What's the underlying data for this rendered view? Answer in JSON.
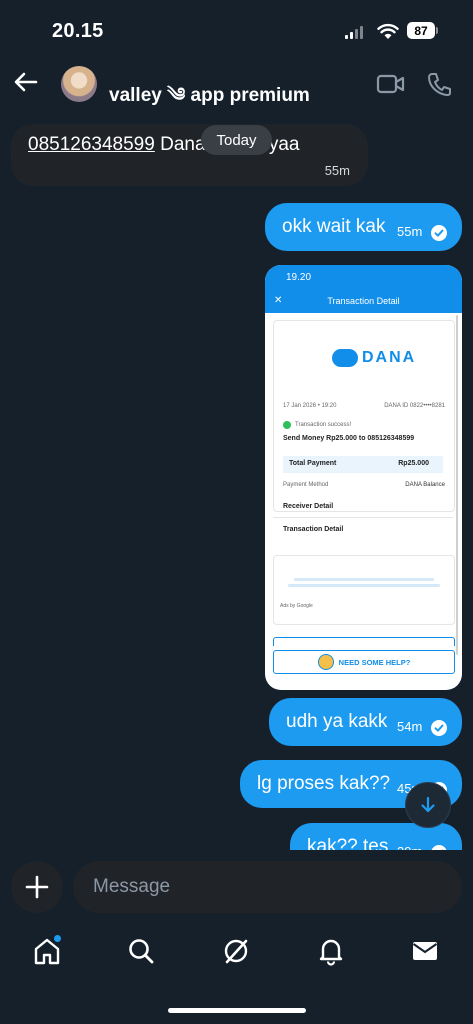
{
  "status_bar": {
    "time": "20.15",
    "battery": "87"
  },
  "header": {
    "title": "valley ༄ app premium"
  },
  "messages": {
    "today_label": "Today",
    "m1": {
      "phone": "085126348599",
      "text_after": " Dana kesinii yaa",
      "time": "55m"
    },
    "m2": {
      "text": "okk wait kak",
      "time": "55m"
    },
    "m3": {
      "text": "udh ya kakk",
      "time": "54m"
    },
    "m4": {
      "text": "lg proses kak??",
      "time": "45m"
    },
    "m5": {
      "text": "kak?? tes",
      "time": "39m"
    }
  },
  "screenshot": {
    "time": "19.20",
    "title": "Transaction Detail",
    "brand": "DANA",
    "date": "17 Jan 2026 • 19:20",
    "dana_id": "DANA ID 0822••••8281",
    "status": "Transaction success!",
    "send_line": "Send Money Rp25.000 to 085126348599",
    "total_label": "Total Payment",
    "total_value": "Rp25.000",
    "method_label": "Payment Method",
    "method_value": "DANA Balance",
    "receiver_label": "Receiver Detail",
    "txn_label": "Transaction Detail",
    "ads_label": "Ads by Google",
    "help_label": "NEED SOME HELP?"
  },
  "composer": {
    "placeholder": "Message"
  },
  "colors": {
    "background": "#15202b",
    "outgoing": "#1d9bf0",
    "incoming": "#202327"
  },
  "icons": [
    "back-arrow-icon",
    "video-call-icon",
    "phone-icon",
    "check-circle-icon",
    "arrow-down-icon",
    "plus-icon",
    "home-icon",
    "search-icon",
    "grok-icon",
    "bell-icon",
    "mail-icon"
  ]
}
